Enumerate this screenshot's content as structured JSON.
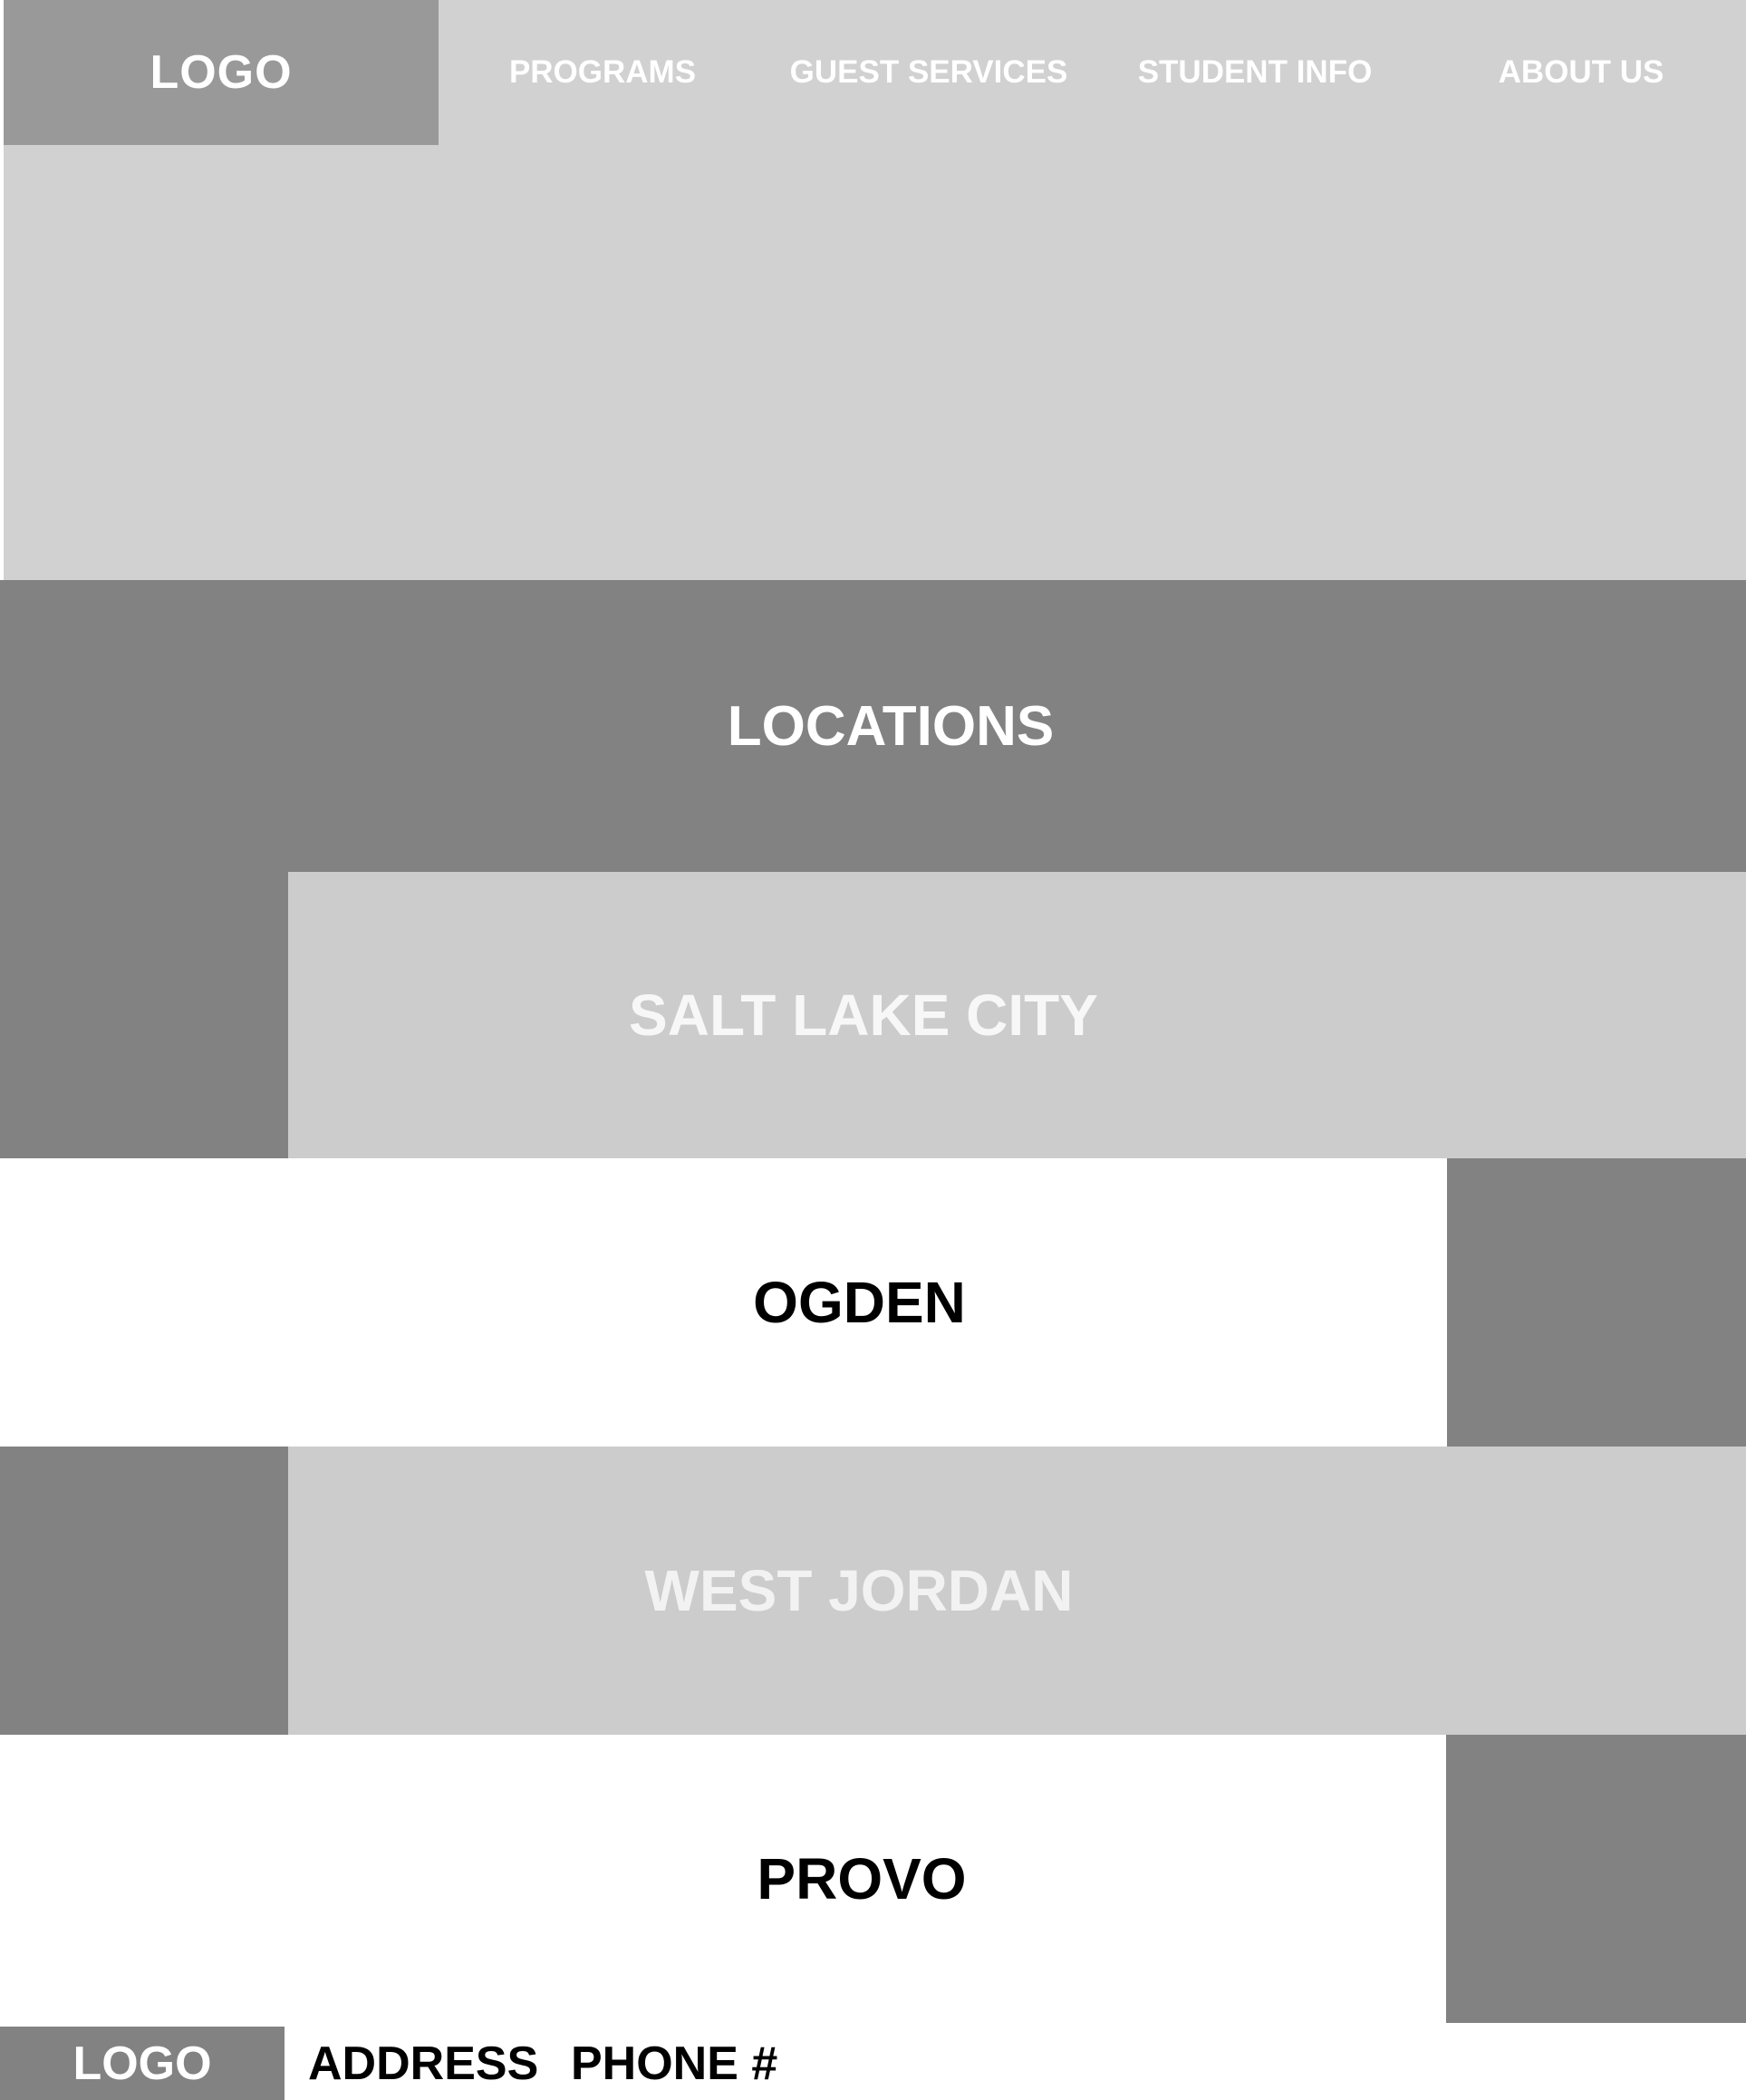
{
  "header": {
    "logo": "LOGO",
    "nav": [
      "PROGRAMS",
      "GUEST SERVICES",
      "STUDENT INFO",
      "ABOUT US"
    ]
  },
  "locations": {
    "title": "LOCATIONS",
    "items": [
      "SALT LAKE CITY",
      "OGDEN",
      "WEST JORDAN",
      "PROVO"
    ]
  },
  "footer": {
    "logo": "LOGO",
    "address": "ADDRESS",
    "phone": "PHONE #"
  },
  "colors": {
    "header_bg": "#d1d1d1",
    "logo_bg": "#999999",
    "dark_block": "#828282",
    "light_panel": "#cccccc",
    "white": "#ffffff"
  }
}
